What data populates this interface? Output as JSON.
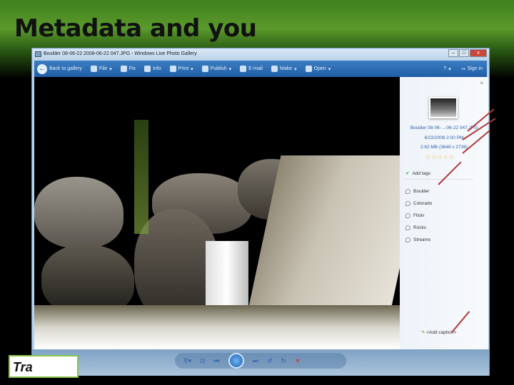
{
  "slide": {
    "title": "Metadata and you",
    "footer_text": "Tra"
  },
  "window": {
    "title": "Boulder 08-06-22 2008-06-22 047.JPG - Windows Live Photo Gallery"
  },
  "toolbar": {
    "items": [
      "Back to gallery",
      "File",
      "Fix",
      "Info",
      "Print",
      "Publish",
      "E-mail",
      "Make",
      "Open"
    ],
    "help": "?",
    "sign_in": "Sign in"
  },
  "info_panel": {
    "close": "×",
    "filename": "Boulder 08-06-...-06-22 047.JPG",
    "datetime": "6/22/2008   2:00 PM",
    "size": "2.62 MB (3648 x 2736)",
    "stars": "☆☆☆☆☆",
    "add_tags": "Add tags",
    "tags": [
      "Boulder",
      "Colorado",
      "Flickr",
      "Rocks",
      "Streams"
    ],
    "caption": "<Add caption>"
  },
  "colors": {
    "toolbar": "#1f5ea6",
    "arrow": "#b0383a"
  }
}
